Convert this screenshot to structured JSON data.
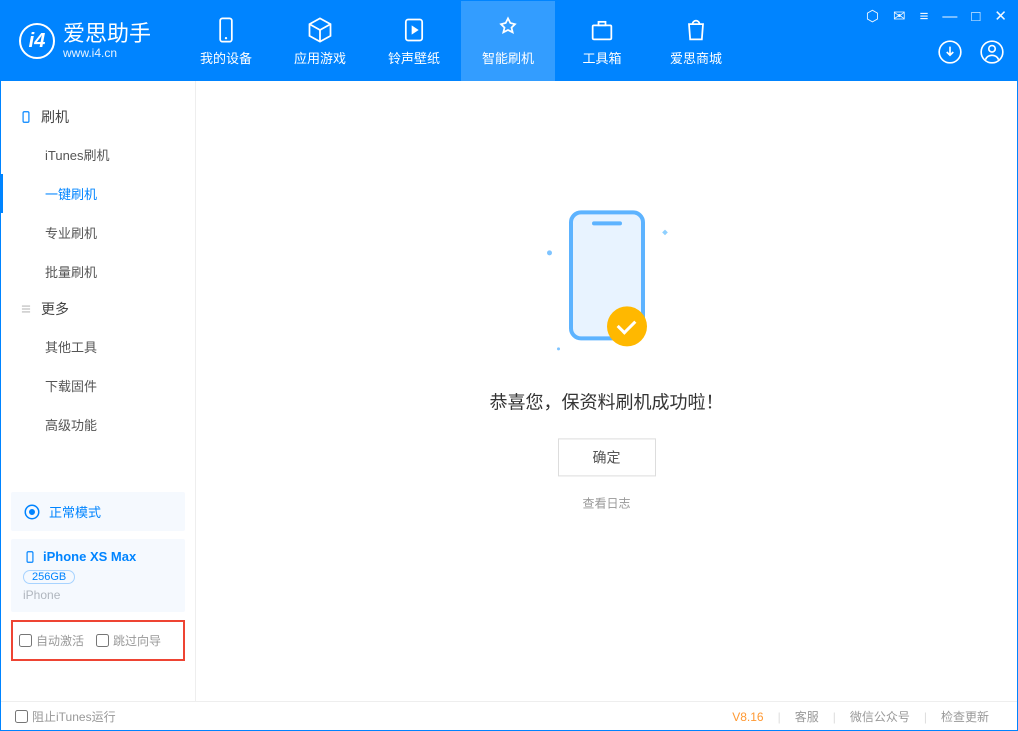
{
  "brand": {
    "name": "爱思助手",
    "site": "www.i4.cn"
  },
  "tabs": [
    {
      "label": "我的设备"
    },
    {
      "label": "应用游戏"
    },
    {
      "label": "铃声壁纸"
    },
    {
      "label": "智能刷机"
    },
    {
      "label": "工具箱"
    },
    {
      "label": "爱思商城"
    }
  ],
  "active_tab": 3,
  "sidebar": {
    "group1": {
      "title": "刷机",
      "items": [
        "iTunes刷机",
        "一键刷机",
        "专业刷机",
        "批量刷机"
      ],
      "active": 1
    },
    "group2": {
      "title": "更多",
      "items": [
        "其他工具",
        "下载固件",
        "高级功能"
      ]
    }
  },
  "mode": "正常模式",
  "device": {
    "name": "iPhone XS Max",
    "capacity": "256GB",
    "type": "iPhone"
  },
  "options": {
    "auto_activate": "自动激活",
    "skip_guide": "跳过向导"
  },
  "result": {
    "msg": "恭喜您，保资料刷机成功啦！",
    "btn": "确定",
    "log": "查看日志"
  },
  "footer": {
    "block_itunes": "阻止iTunes运行",
    "version": "V8.16",
    "service": "客服",
    "wechat": "微信公众号",
    "update": "检查更新"
  }
}
